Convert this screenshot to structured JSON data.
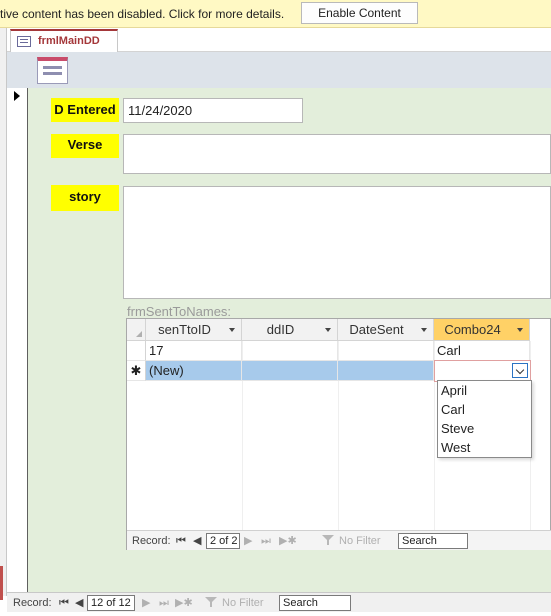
{
  "message_bar": {
    "text": "tive content has been disabled. Click for more details.",
    "button": "Enable Content"
  },
  "tab": {
    "label": "frmlMainDD"
  },
  "main_form": {
    "date_entered_label": "D Entered",
    "date_entered_value": "11/24/2020",
    "verse_label": "Verse",
    "verse_value": "",
    "story_label": "story",
    "story_value": ""
  },
  "subform": {
    "caption": "frmSentToNames:",
    "columns": [
      "senTtoID",
      "ddID",
      "DateSent",
      "Combo24"
    ],
    "rows": [
      {
        "marker": "",
        "senTtoID": "17",
        "ddID": "",
        "DateSent": "",
        "Combo24": "Carl"
      },
      {
        "marker": "✱",
        "senTtoID": "(New)",
        "ddID": "",
        "DateSent": "",
        "Combo24": ""
      }
    ],
    "combo_options": [
      "April",
      "Carl",
      "Steve",
      "West"
    ],
    "nav": {
      "record_label": "Record:",
      "position": "2 of 2",
      "filter": "No Filter",
      "search": "Search"
    }
  },
  "main_nav": {
    "record_label": "Record:",
    "position": "12 of 12",
    "filter": "No Filter",
    "search": "Search"
  },
  "colors": {
    "detail_bg": "#e3eedb",
    "label_bg": "#ffff00",
    "active_header": "#ffd166",
    "new_row": "#a7caeb",
    "message_bar": "#fff9c4"
  }
}
